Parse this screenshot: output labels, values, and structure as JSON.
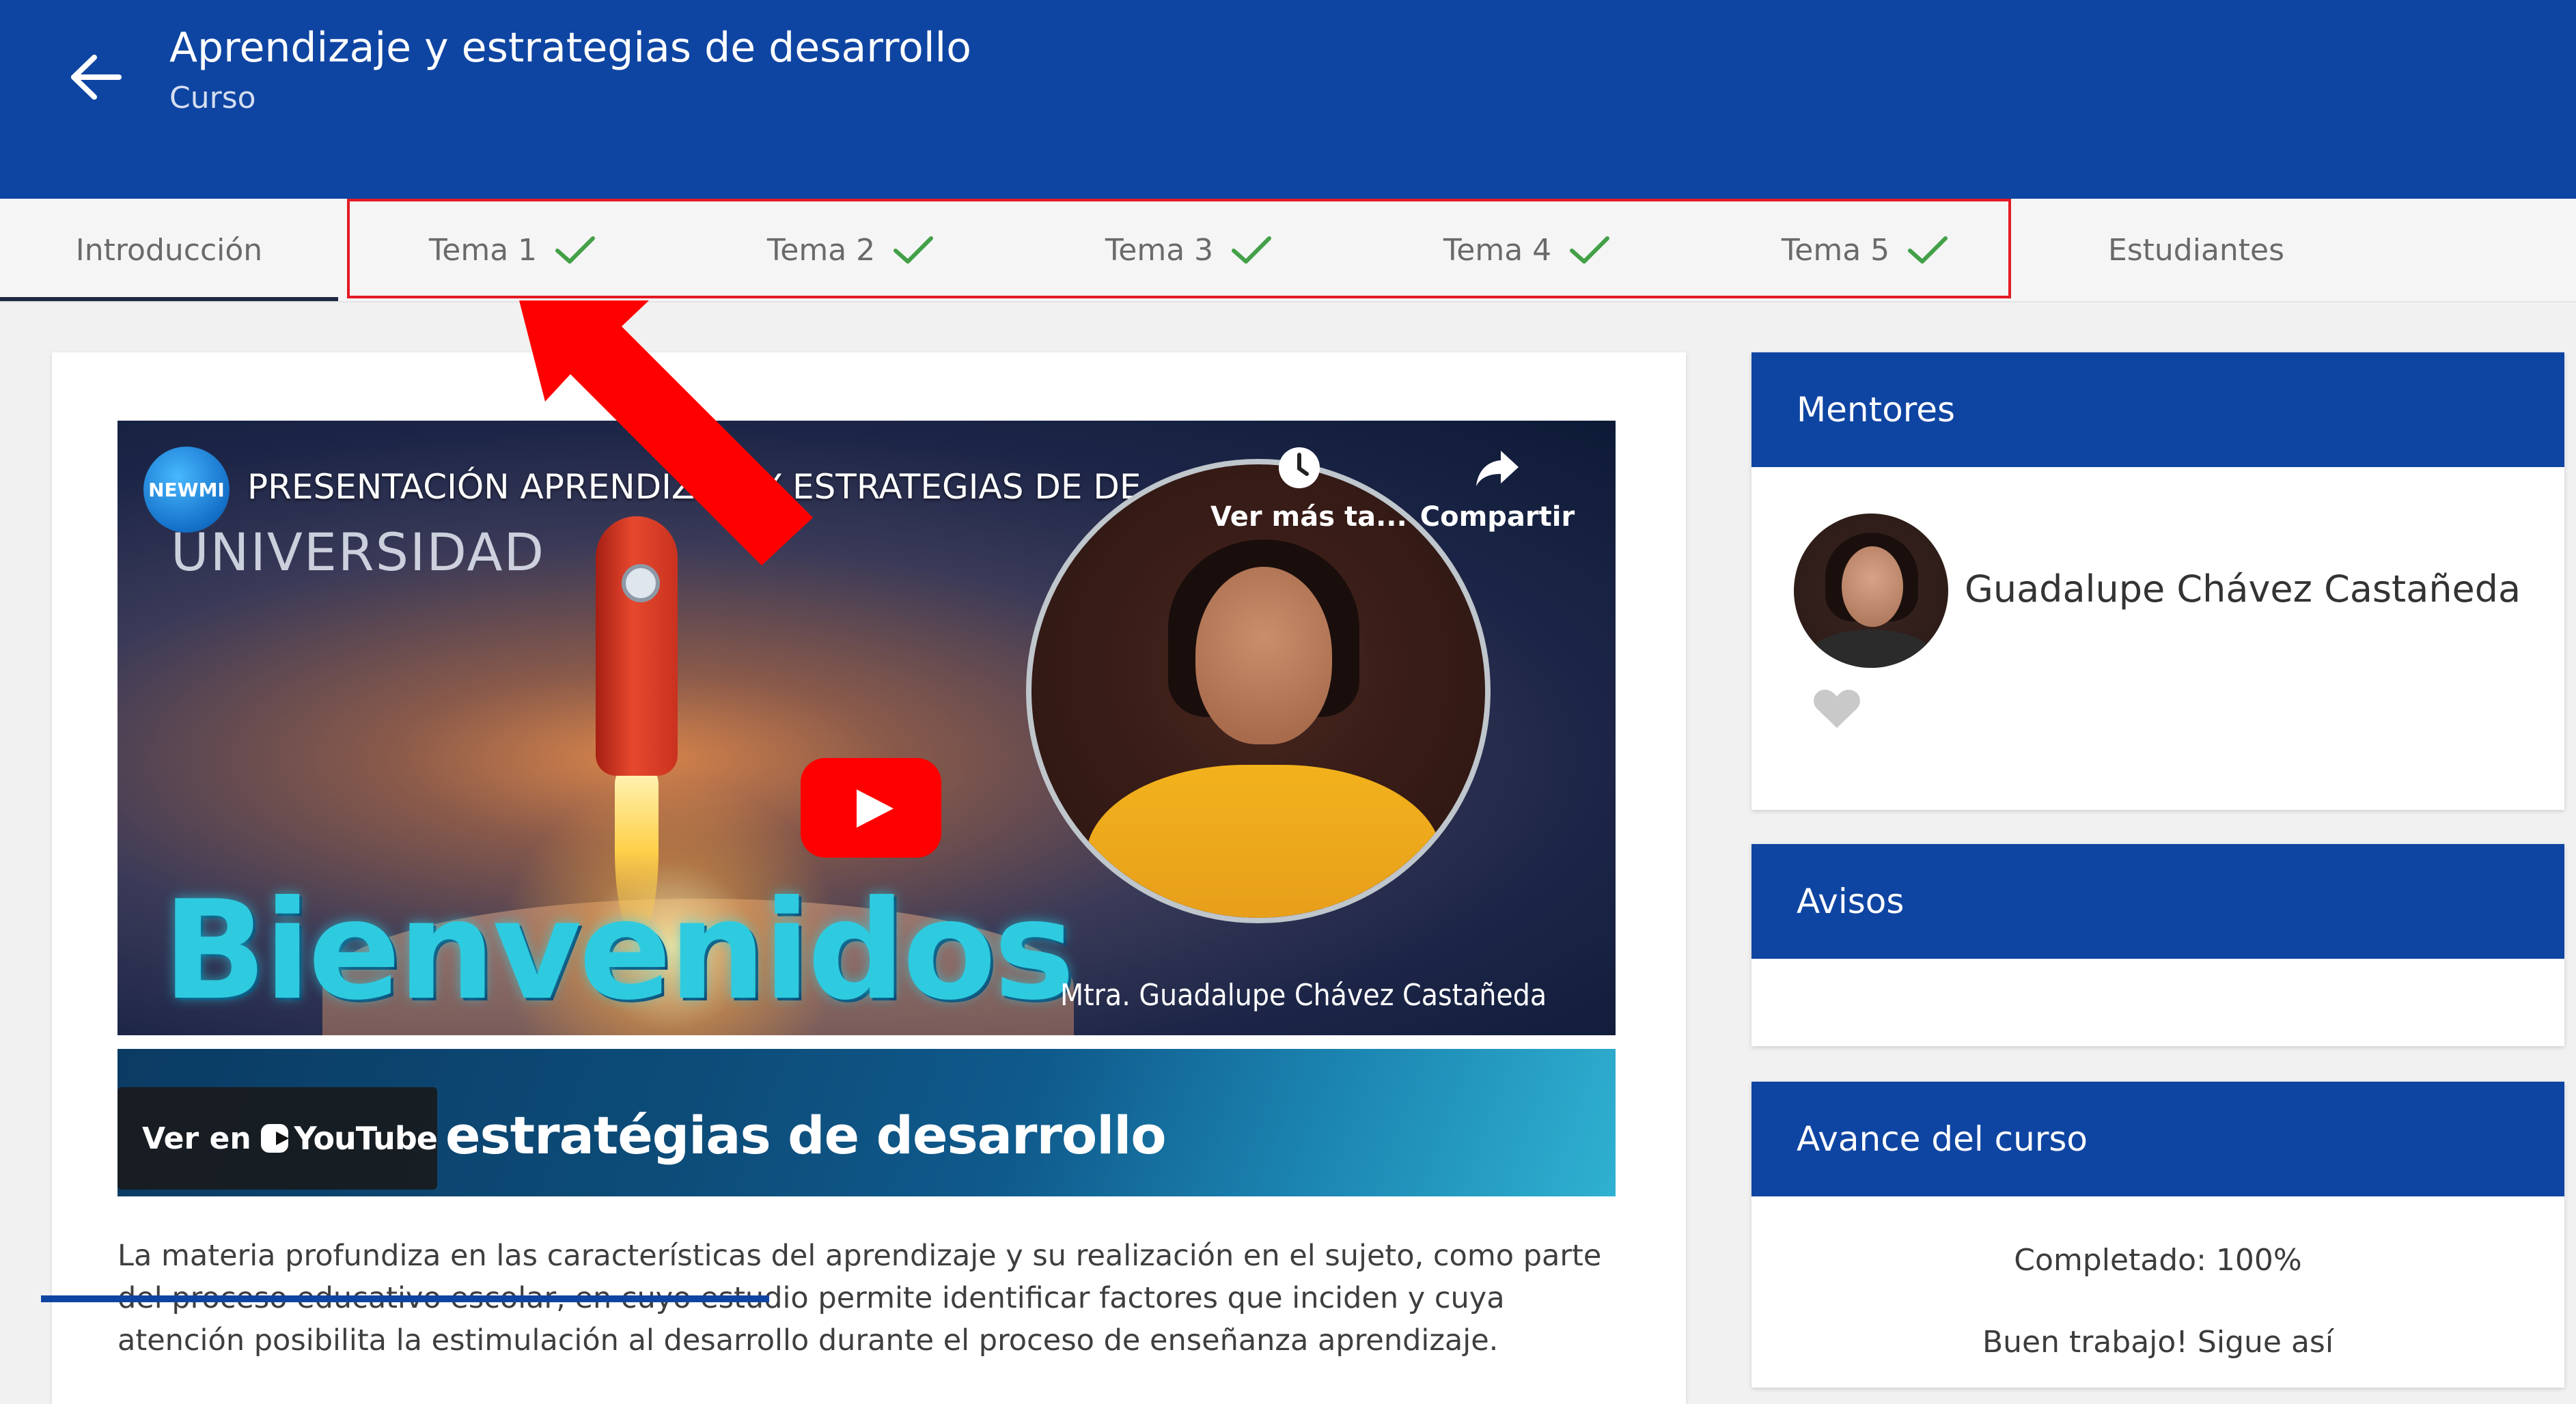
{
  "header": {
    "title": "Aprendizaje y estrategias de desarrollo",
    "subtitle": "Curso",
    "back_icon": "arrow-left-icon"
  },
  "tabs": [
    {
      "label": "Introducción",
      "completed": false,
      "active": true
    },
    {
      "label": "Tema 1",
      "completed": true,
      "active": false
    },
    {
      "label": "Tema 2",
      "completed": true,
      "active": false
    },
    {
      "label": "Tema 3",
      "completed": true,
      "active": false
    },
    {
      "label": "Tema 4",
      "completed": true,
      "active": false
    },
    {
      "label": "Tema 5",
      "completed": true,
      "active": false
    },
    {
      "label": "Estudiantes",
      "completed": false,
      "active": false
    }
  ],
  "video": {
    "channel_logo": "NEWMI",
    "title": "PRESENTACIÓN APRENDIZAJE Y ESTRATEGIAS DE DE...",
    "watch_later_label": "Ver más ta...",
    "share_label": "Compartir",
    "brand_text": "UNIVERSIDAD",
    "welcome_text": "Bienvenidos",
    "presenter_caption": "Mtra. Guadalupe Chávez Castañeda",
    "bottom_text": "estratégias de desarrollo",
    "watch_on_label": "Ver en",
    "youtube_label": "YouTube"
  },
  "description": "La materia profundiza en las características del aprendizaje y su realización en el sujeto, como parte del proceso educativo escolar, en cuyo estudio permite identificar factores que inciden y cuya atención posibilita la estimulación al desarrollo durante el proceso de enseñanza aprendizaje.",
  "sidebar": {
    "mentores": {
      "title": "Mentores",
      "mentor_name": "Guadalupe Chávez Castañeda",
      "favorite_icon": "heart-icon"
    },
    "avisos": {
      "title": "Avisos"
    },
    "avance": {
      "title": "Avance del curso",
      "completed_label": "Completado: 100%",
      "progress": 1.0,
      "message": "Buen trabajo! Sigue así"
    }
  },
  "colors": {
    "primary": "#0f45a2",
    "highlight_border": "#e31b23",
    "check": "#43a047",
    "youtube_red": "#ff0000"
  }
}
